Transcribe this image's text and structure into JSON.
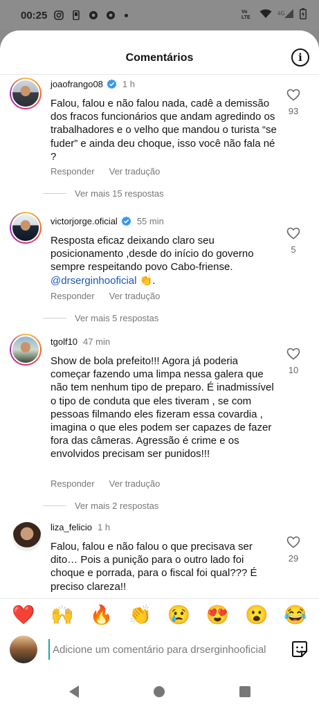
{
  "status_bar": {
    "time": "00:25"
  },
  "header": {
    "title": "Comentários",
    "info_icon": "i"
  },
  "comments": [
    {
      "username": "joaofrango08",
      "verified": true,
      "time": "1 h",
      "text": "Falou, falou e não falou nada, cadê a demissão dos fracos funcionários que andam agredindo os trabalhadores e o velho que mandou o turista “se fuder” e ainda deu choque, isso você não fala né ?",
      "reply_label": "Responder",
      "translate_label": "Ver tradução",
      "likes": "93",
      "more_replies": "Ver mais 15 respostas"
    },
    {
      "username": "victorjorge.oficial",
      "verified": true,
      "time": "55 min",
      "text": "Resposta eficaz deixando claro seu posicionamento ,desde do início do governo sempre respeitando povo Cabo-friense.",
      "mention": "@drserginhooficial",
      "suffix": " 👏.",
      "reply_label": "Responder",
      "translate_label": "Ver tradução",
      "likes": "5",
      "more_replies": "Ver mais 5 respostas"
    },
    {
      "username": "tgolf10",
      "verified": false,
      "time": "47 min",
      "text": "Show de bola prefeito!!! Agora já poderia começar fazendo uma limpa nessa galera que não tem nenhum tipo de preparo. É inadmissível o tipo de conduta que eles tiveram , se com pessoas filmando eles fizeram essa covardia , imagina o que eles podem ser capazes de fazer fora das câmeras.  Agressão é crime e os envolvidos precisam ser punidos!!!",
      "reply_label": "Responder",
      "translate_label": "Ver tradução",
      "likes": "10",
      "more_replies": "Ver mais 2 respostas"
    },
    {
      "username": "liza_felicio",
      "verified": false,
      "time": "1 h",
      "text": "Falou, falou e não falou o que precisava ser dito… Pois a punição para o outro lado foi choque e porrada, para o fiscal foi qual??? É preciso clareza!!",
      "likes": "29"
    }
  ],
  "emoji_bar": [
    "❤️",
    "🙌",
    "🔥",
    "👏",
    "😢",
    "😍",
    "😮",
    "😂"
  ],
  "input": {
    "placeholder": "Adicione um comentário para drserginhooficial"
  },
  "colors": {
    "link": "#1a56b3",
    "verified": "#3897f0",
    "heart_red": "#e0245e"
  }
}
